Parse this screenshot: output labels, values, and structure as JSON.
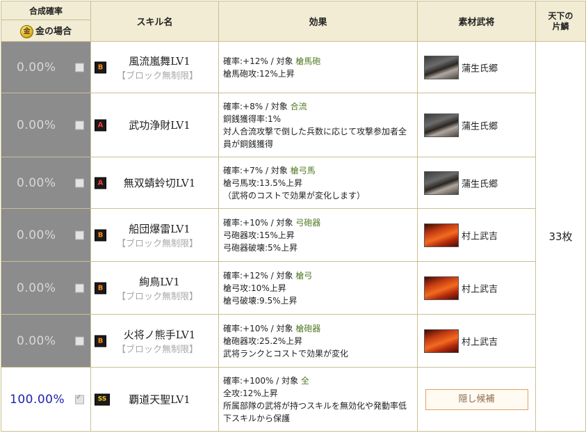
{
  "header": {
    "rate_title": "合成確率",
    "gold_icon_label": "金",
    "gold_label": "金の場合",
    "skill_col": "スキル名",
    "effect_col": "効果",
    "material_col": "素材武将",
    "tenka_col": "天下の片鱗"
  },
  "rows": [
    {
      "rate": "0.00%",
      "checked": false,
      "rank": "B",
      "skill": "風流嵐舞LV1",
      "sub": "【ブロック無制限】",
      "effect": [
        "確率:+12% / 対象 ",
        "槍馬砲",
        "槍馬砲攻:12%上昇",
        ""
      ],
      "material": "蒲生氏郷",
      "portrait": "p1"
    },
    {
      "rate": "0.00%",
      "checked": false,
      "rank": "A",
      "skill": "武功浄財LV1",
      "sub": "",
      "effect": [
        "確率:+8% / 対象 ",
        "合流",
        "銅銭獲得率:1%",
        "対人合流攻撃で倒した兵数に応じて攻撃参加者全員が銅銭獲得"
      ],
      "material": "蒲生氏郷",
      "portrait": "p1"
    },
    {
      "rate": "0.00%",
      "checked": false,
      "rank": "A",
      "skill": "無双蜻蛉切LV1",
      "sub": "",
      "effect": [
        "確率:+7% / 対象 ",
        "槍弓馬",
        "槍弓馬攻:13.5%上昇",
        "（武将のコストで効果が変化します）"
      ],
      "material": "蒲生氏郷",
      "portrait": "p1"
    },
    {
      "rate": "0.00%",
      "checked": false,
      "rank": "B",
      "skill": "船団爆雷LV1",
      "sub": "【ブロック無制限】",
      "effect": [
        "確率:+10% / 対象 ",
        "弓砲器",
        "弓砲器攻:15%上昇",
        "弓砲器破壊:5%上昇"
      ],
      "material": "村上武吉",
      "portrait": "p2"
    },
    {
      "rate": "0.00%",
      "checked": false,
      "rank": "B",
      "skill": "絢鳥LV1",
      "sub": "【ブロック無制限】",
      "effect": [
        "確率:+12% / 対象 ",
        "槍弓",
        "槍弓攻:10%上昇",
        "槍弓破壊:9.5%上昇"
      ],
      "material": "村上武吉",
      "portrait": "p2"
    },
    {
      "rate": "0.00%",
      "checked": false,
      "rank": "B",
      "skill": "火将ノ熊手LV1",
      "sub": "【ブロック無制限】",
      "effect": [
        "確率:+10% / 対象 ",
        "槍砲器",
        "槍砲器攻:25.2%上昇",
        "武将ランクとコストで効果が変化"
      ],
      "material": "村上武吉",
      "portrait": "p2"
    },
    {
      "rate": "100.00%",
      "checked": true,
      "rank": "SS",
      "skill": "覇道天聖LV1",
      "sub": "",
      "effect": [
        "確率:+100% / 対象 ",
        "全",
        "全攻:12%上昇",
        "所属部隊の武将が持つスキルを無効化や発動率低下スキルから保護"
      ],
      "material_button": "隠し候補"
    }
  ],
  "tenka_value": "33枚"
}
